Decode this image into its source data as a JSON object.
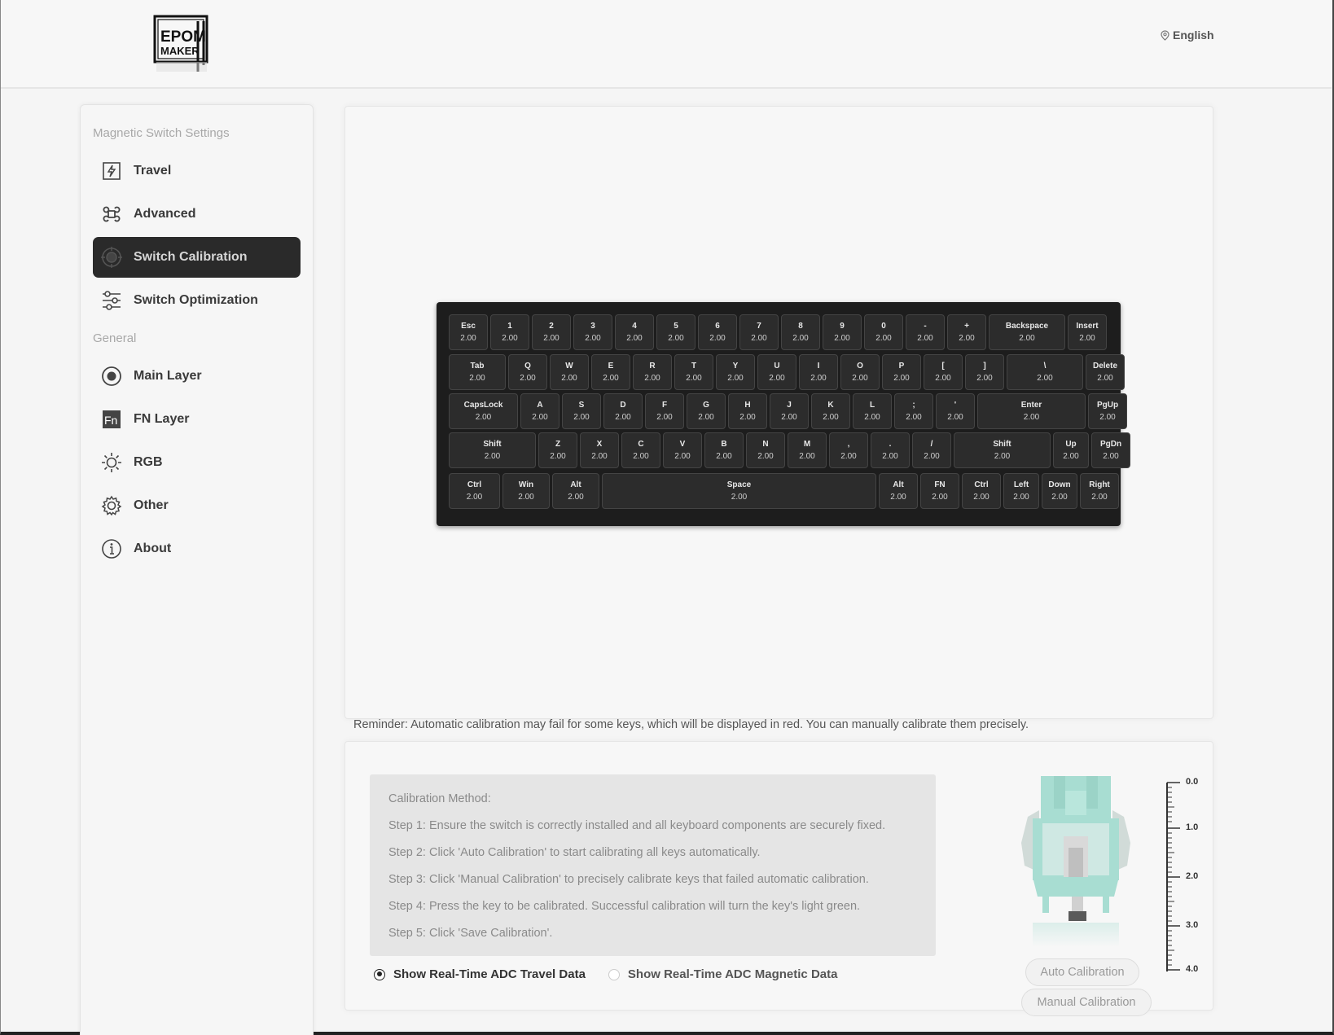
{
  "header": {
    "logo_text": "EPOMAKER",
    "language": "English",
    "language_icon": "location-pin-icon"
  },
  "sidebar": {
    "magnetic_title": "Magnetic Switch Settings",
    "general_title": "General",
    "magnetic_items": [
      {
        "label": "Travel",
        "icon": "travel-icon"
      },
      {
        "label": "Advanced",
        "icon": "command-icon"
      },
      {
        "label": "Switch Calibration",
        "icon": "target-icon",
        "active": true
      },
      {
        "label": "Switch Optimization",
        "icon": "sliders-icon"
      }
    ],
    "general_items": [
      {
        "label": "Main Layer",
        "icon": "radio-circle-icon"
      },
      {
        "label": "FN Layer",
        "icon": "fn-icon"
      },
      {
        "label": "RGB",
        "icon": "sun-icon"
      },
      {
        "label": "Other",
        "icon": "gear-icon"
      },
      {
        "label": "About",
        "icon": "info-icon"
      }
    ]
  },
  "keyboard": {
    "rows": [
      [
        {
          "label": "Esc",
          "value": "2.00"
        },
        {
          "label": "1",
          "value": "2.00"
        },
        {
          "label": "2",
          "value": "2.00"
        },
        {
          "label": "3",
          "value": "2.00"
        },
        {
          "label": "4",
          "value": "2.00"
        },
        {
          "label": "5",
          "value": "2.00"
        },
        {
          "label": "6",
          "value": "2.00"
        },
        {
          "label": "7",
          "value": "2.00"
        },
        {
          "label": "8",
          "value": "2.00"
        },
        {
          "label": "9",
          "value": "2.00"
        },
        {
          "label": "0",
          "value": "2.00"
        },
        {
          "label": "-",
          "value": "2.00"
        },
        {
          "label": "+",
          "value": "2.00"
        },
        {
          "label": "Backspace",
          "value": "2.00"
        },
        {
          "label": "Insert",
          "value": "2.00"
        }
      ],
      [
        {
          "label": "Tab",
          "value": "2.00"
        },
        {
          "label": "Q",
          "value": "2.00"
        },
        {
          "label": "W",
          "value": "2.00"
        },
        {
          "label": "E",
          "value": "2.00"
        },
        {
          "label": "R",
          "value": "2.00"
        },
        {
          "label": "T",
          "value": "2.00"
        },
        {
          "label": "Y",
          "value": "2.00"
        },
        {
          "label": "U",
          "value": "2.00"
        },
        {
          "label": "I",
          "value": "2.00"
        },
        {
          "label": "O",
          "value": "2.00"
        },
        {
          "label": "P",
          "value": "2.00"
        },
        {
          "label": "[",
          "value": "2.00"
        },
        {
          "label": "]",
          "value": "2.00"
        },
        {
          "label": "\\",
          "value": "2.00"
        },
        {
          "label": "Delete",
          "value": "2.00"
        }
      ],
      [
        {
          "label": "CapsLock",
          "value": "2.00"
        },
        {
          "label": "A",
          "value": "2.00"
        },
        {
          "label": "S",
          "value": "2.00"
        },
        {
          "label": "D",
          "value": "2.00"
        },
        {
          "label": "F",
          "value": "2.00"
        },
        {
          "label": "G",
          "value": "2.00"
        },
        {
          "label": "H",
          "value": "2.00"
        },
        {
          "label": "J",
          "value": "2.00"
        },
        {
          "label": "K",
          "value": "2.00"
        },
        {
          "label": "L",
          "value": "2.00"
        },
        {
          "label": ";",
          "value": "2.00"
        },
        {
          "label": "'",
          "value": "2.00"
        },
        {
          "label": "Enter",
          "value": "2.00"
        },
        {
          "label": "PgUp",
          "value": "2.00"
        }
      ],
      [
        {
          "label": "Shift",
          "value": "2.00"
        },
        {
          "label": "Z",
          "value": "2.00"
        },
        {
          "label": "X",
          "value": "2.00"
        },
        {
          "label": "C",
          "value": "2.00"
        },
        {
          "label": "V",
          "value": "2.00"
        },
        {
          "label": "B",
          "value": "2.00"
        },
        {
          "label": "N",
          "value": "2.00"
        },
        {
          "label": "M",
          "value": "2.00"
        },
        {
          "label": ",",
          "value": "2.00"
        },
        {
          "label": ".",
          "value": "2.00"
        },
        {
          "label": "/",
          "value": "2.00"
        },
        {
          "label": "Shift",
          "value": "2.00"
        },
        {
          "label": "Up",
          "value": "2.00"
        },
        {
          "label": "PgDn",
          "value": "2.00"
        }
      ],
      [
        {
          "label": "Ctrl",
          "value": "2.00"
        },
        {
          "label": "Win",
          "value": "2.00"
        },
        {
          "label": "Alt",
          "value": "2.00"
        },
        {
          "label": "Space",
          "value": "2.00"
        },
        {
          "label": "Alt",
          "value": "2.00"
        },
        {
          "label": "FN",
          "value": "2.00"
        },
        {
          "label": "Ctrl",
          "value": "2.00"
        },
        {
          "label": "Left",
          "value": "2.00"
        },
        {
          "label": "Down",
          "value": "2.00"
        },
        {
          "label": "Right",
          "value": "2.00"
        }
      ]
    ]
  },
  "reminder": "Reminder: Automatic calibration may fail for some keys, which will be displayed in red. You can manually calibrate them precisely.",
  "calibration": {
    "method_title": "Calibration Method:",
    "steps": [
      "Step 1: Ensure the switch is correctly installed and all keyboard components are securely fixed.",
      "Step 2: Click 'Auto Calibration' to start calibrating all keys automatically.",
      "Step 3: Click 'Manual Calibration' to precisely calibrate keys that failed automatic calibration.",
      "Step 4: Press the key to be calibrated. Successful calibration will turn the key's light green.",
      "Step 5: Click 'Save Calibration'."
    ],
    "radio_travel": "Show Real-Time ADC Travel Data",
    "radio_magnetic": "Show Real-Time ADC Magnetic Data",
    "selected_radio": "travel",
    "scale_labels": [
      "0.0",
      "1.0",
      "2.0",
      "3.0",
      "4.0"
    ],
    "auto_button": "Auto Calibration",
    "manual_button": "Manual Calibration",
    "switch_color": "#a8ddd2"
  }
}
